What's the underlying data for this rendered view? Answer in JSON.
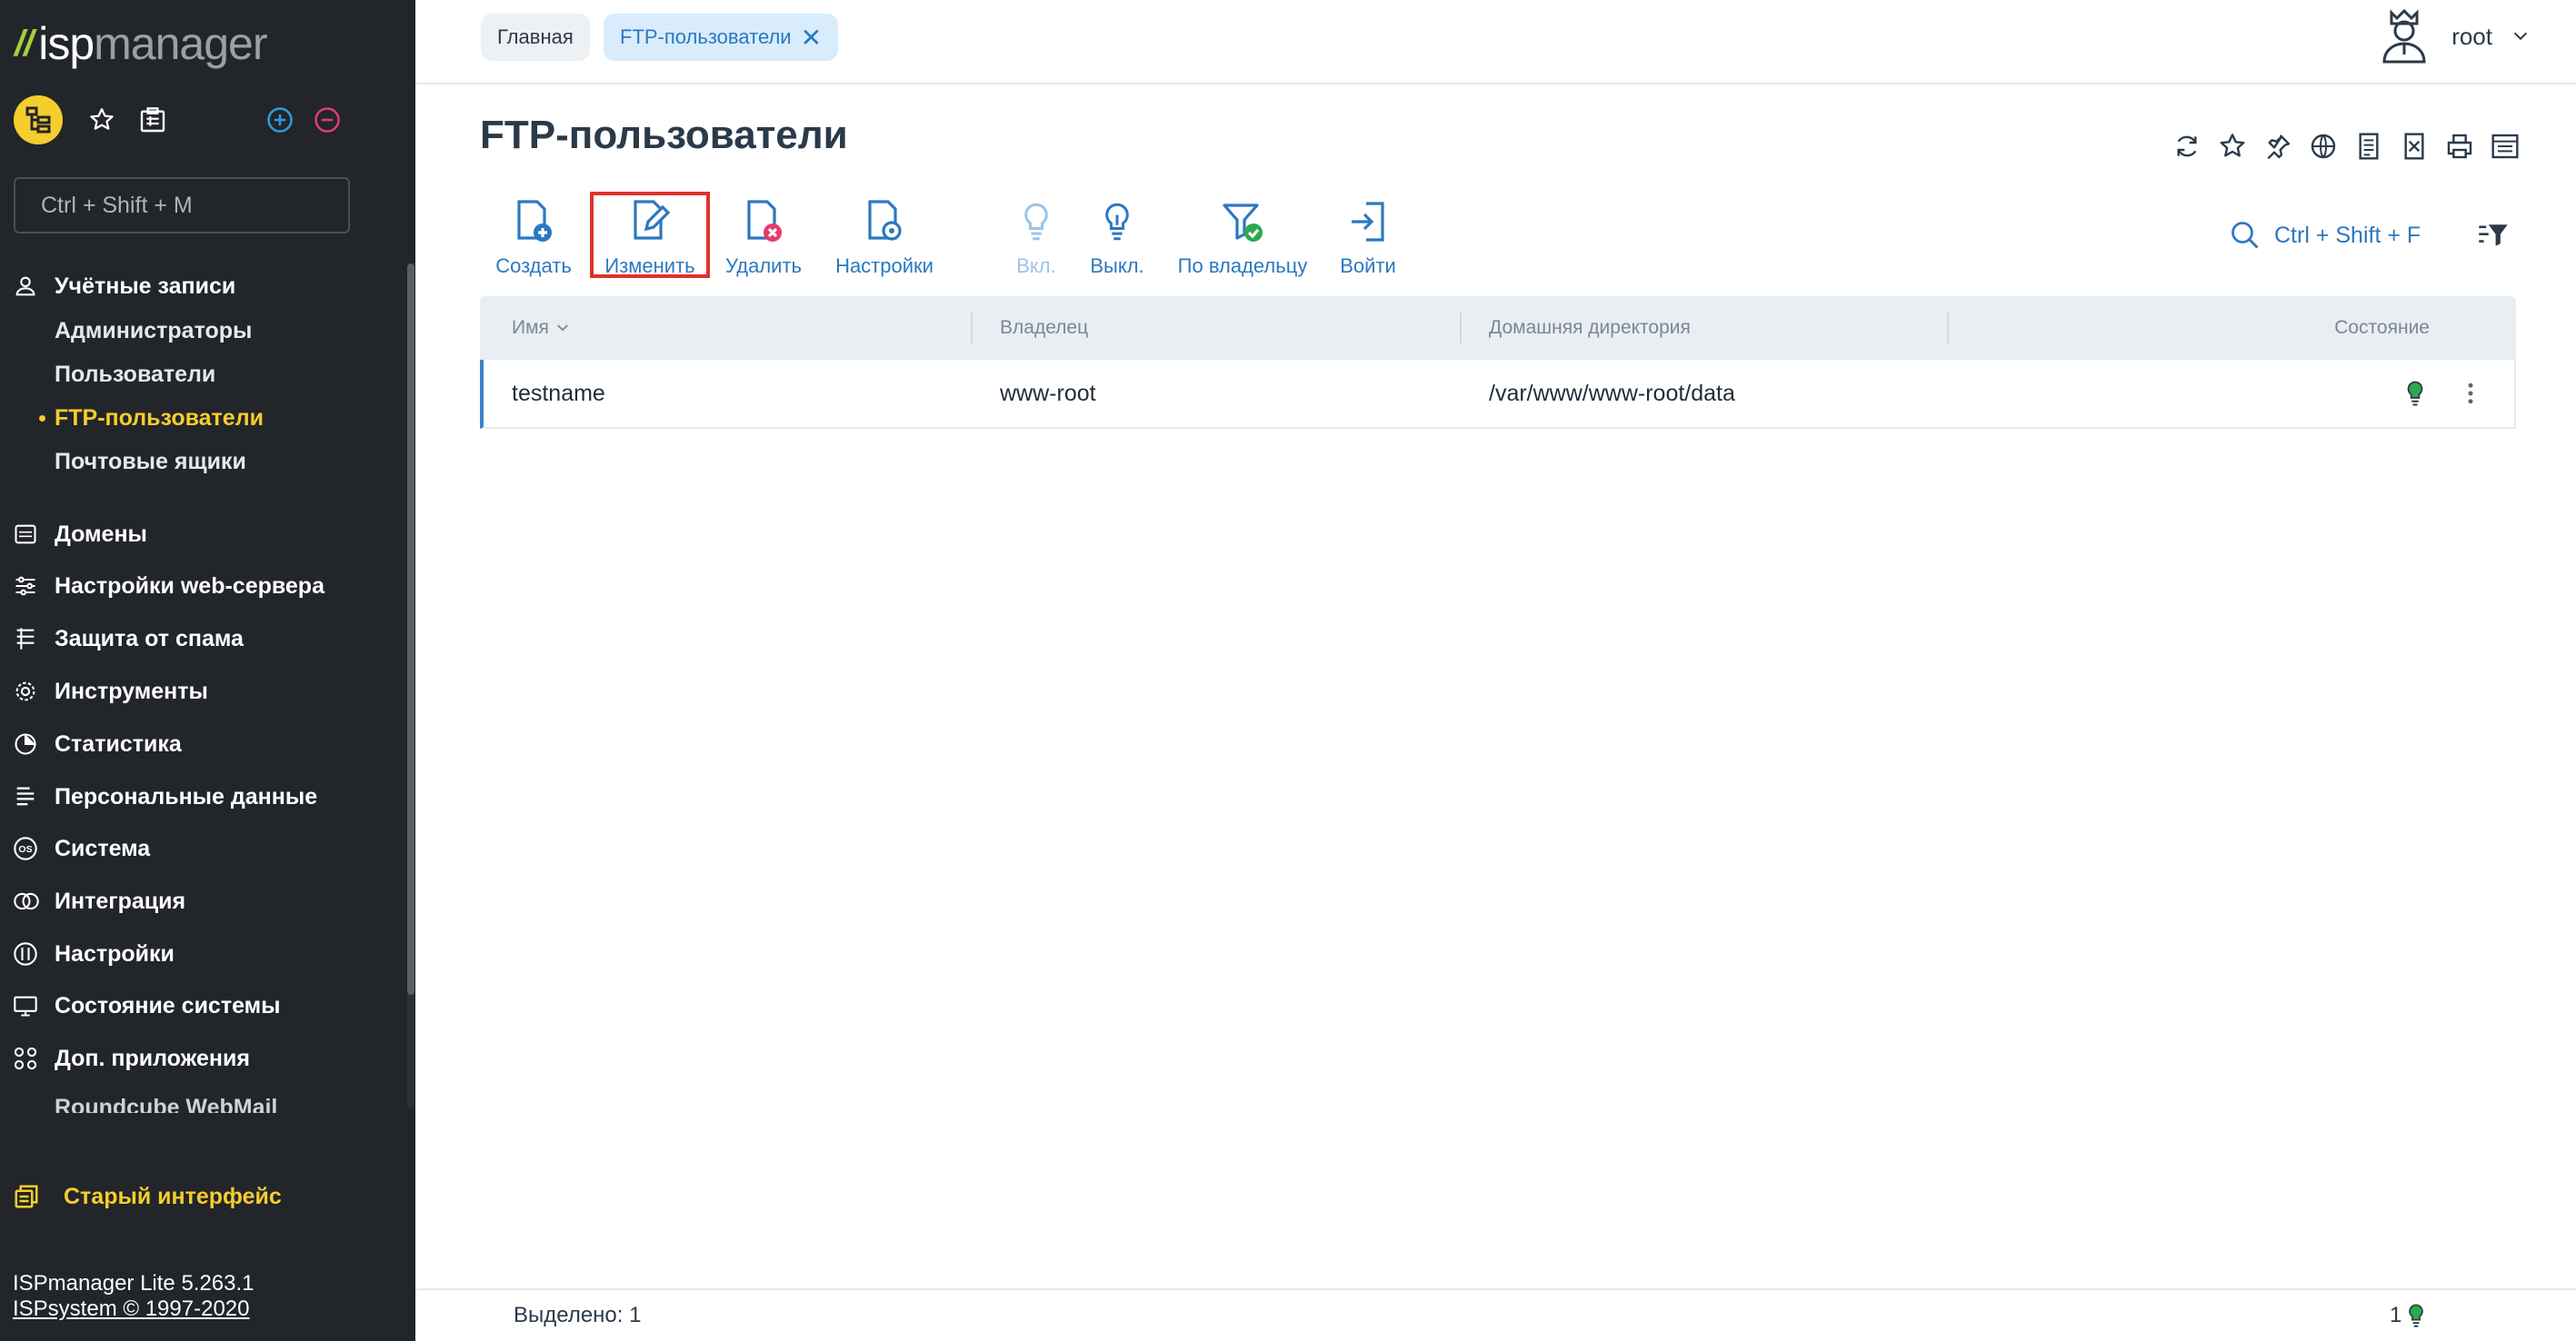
{
  "app": {
    "logo_isp": "isp",
    "logo_manager": "manager"
  },
  "sidebar": {
    "search_placeholder": "Ctrl + Shift + M",
    "groups": {
      "accounts": {
        "label": "Учётные записи",
        "items": [
          "Администраторы",
          "Пользователи",
          "FTP-пользователи",
          "Почтовые ящики"
        ],
        "active": "FTP-пользователи"
      },
      "domains": "Домены",
      "webserver": "Настройки web-сервера",
      "antispam": "Защита от спама",
      "tools": "Инструменты",
      "stats": "Статистика",
      "personal": "Персональные данные",
      "system": "Система",
      "integration": "Интеграция",
      "settings": "Настройки",
      "sysstate": "Состояние системы",
      "apps": "Доп. приложения",
      "apps_partial": "Roundcube WebMail"
    },
    "old_interface": "Старый интерфейс",
    "version": "ISPmanager Lite 5.263.1",
    "copyright": "ISPsystem © 1997-2020"
  },
  "topbar": {
    "tabs": [
      {
        "label": "Главная"
      },
      {
        "label": "FTP-пользователи"
      }
    ],
    "user": "root"
  },
  "page": {
    "title": "FTP-пользователи"
  },
  "toolbar": {
    "create": "Создать",
    "edit": "Изменить",
    "delete": "Удалить",
    "settings": "Настройки",
    "enable": "Вкл.",
    "disable": "Выкл.",
    "by_owner": "По владельцу",
    "login": "Войти",
    "quick_search": "Ctrl + Shift + F"
  },
  "table": {
    "columns": [
      "Имя",
      "Владелец",
      "Домашняя директория",
      "Состояние"
    ],
    "rows": [
      {
        "name": "testname",
        "owner": "www-root",
        "home": "/var/www/www-root/data",
        "status": "enabled"
      }
    ]
  },
  "footer": {
    "selected": "Выделено: 1",
    "count": "1"
  },
  "colors": {
    "accent": "#2c78c0",
    "sidebar_bg": "#22252a",
    "active_yellow": "#f5cd2d",
    "highlight_red": "#e0312b",
    "status_green": "#2fa84f"
  },
  "icons": [
    "sitemap-icon",
    "star-icon",
    "clipboard-icon",
    "plus-circle-icon",
    "minus-circle-icon",
    "refresh-icon",
    "pin-icon",
    "globe-icon",
    "export-icon",
    "excel-icon",
    "print-icon",
    "table-settings-icon",
    "search-icon",
    "filter-icon",
    "bulb-icon",
    "kebab-icon"
  ]
}
